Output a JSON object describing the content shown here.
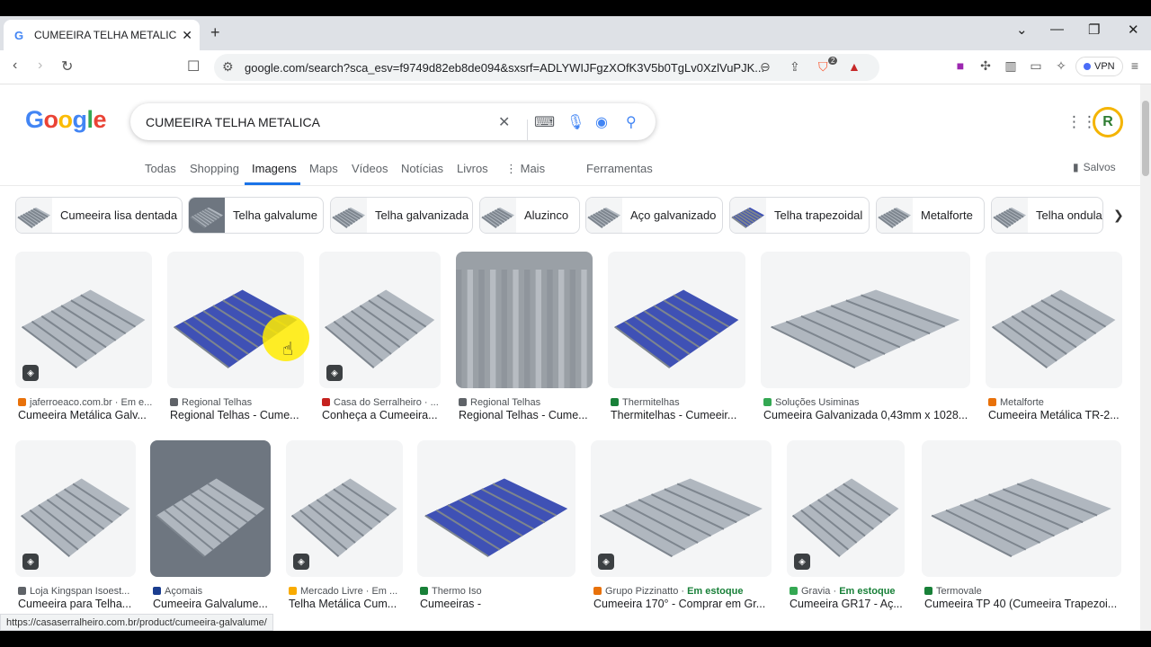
{
  "browser": {
    "tab_title": "CUMEEIRA TELHA METALICA - ",
    "tab_close": "✕",
    "new_tab": "+",
    "url": "google.com/search?sca_esv=f9749d82eb8de094&sxsrf=ADLYWIJFgzXOfK3V5b0TgLv0XzlVuPJK...",
    "vpn_label": "VPN",
    "ext_badge": "2",
    "status_url": "https://casaserralheiro.com.br/product/cumeeira-galvalume/"
  },
  "google": {
    "query": "CUMEEIRA TELHA METALICA",
    "logo_letters": [
      {
        "ch": "G",
        "color": "#4285F4"
      },
      {
        "ch": "o",
        "color": "#EA4335"
      },
      {
        "ch": "o",
        "color": "#FBBC05"
      },
      {
        "ch": "g",
        "color": "#4285F4"
      },
      {
        "ch": "l",
        "color": "#34A853"
      },
      {
        "ch": "e",
        "color": "#EA4335"
      }
    ],
    "tabs": [
      "Todas",
      "Shopping",
      "Imagens",
      "Maps",
      "Vídeos",
      "Notícias",
      "Livros",
      "Mais",
      "Ferramentas"
    ],
    "active_tab": "Imagens",
    "more_dots": "⋮",
    "saved_label": "Salvos",
    "avatar_letter": "R"
  },
  "chips": [
    "Cumeeira lisa dentada",
    "Telha galvalume",
    "Telha galvanizada",
    "Aluzinco",
    "Aço galvanizado",
    "Telha trapezoidal",
    "Metalforte",
    "Telha ondulada"
  ],
  "results_row1": [
    {
      "source": "jaferroeaco.com.br · Em e...",
      "title": "Cumeeira Metálica Galv...",
      "color": "#e8710a"
    },
    {
      "source": "Regional Telhas",
      "title": "Regional Telhas - Cume...",
      "color": "#5f6368"
    },
    {
      "source": "Casa do Serralheiro · ...",
      "title": "Conheça a Cumeeira...",
      "color": "#c5221f"
    },
    {
      "source": "Regional Telhas",
      "title": "Regional Telhas - Cume...",
      "color": "#5f6368"
    },
    {
      "source": "Thermitelhas",
      "title": "Thermitelhas - Cumeeir...",
      "color": "#188038"
    },
    {
      "source": "Soluções Usiminas",
      "title": "Cumeeira Galvanizada 0,43mm x 1028...",
      "color": "#34a853"
    },
    {
      "source": "Metalforte",
      "title": "Cumeeira Metálica TR-2...",
      "color": "#e8710a"
    }
  ],
  "results_row2": [
    {
      "source": "Loja Kingspan Isoest...",
      "title": "Cumeeira para Telha...",
      "color": "#5f6368",
      "stock": ""
    },
    {
      "source": "Açomais",
      "title": "Cumeeira Galvalume...",
      "color": "#1a3d8f",
      "stock": ""
    },
    {
      "source": "Mercado Livre · Em ...",
      "title": "Telha Metálica Cum...",
      "color": "#f9ab00",
      "stock": ""
    },
    {
      "source": "Thermo Iso",
      "title": "Cumeeiras -",
      "color": "#188038",
      "stock": ""
    },
    {
      "source": "Grupo Pizzinatto · ",
      "title": "Cumeeira 170° - Comprar em Gr...",
      "color": "#e8710a",
      "stock": "Em estoque"
    },
    {
      "source": "Gravia · ",
      "title": "Cumeeira GR17 - Aç...",
      "color": "#34a853",
      "stock": "Em estoque"
    },
    {
      "source": "Termovale",
      "title": "Cumeeira TP 40 (Cumeeira Trapezoi...",
      "color": "#188038",
      "stock": ""
    }
  ],
  "colors": {
    "accent": "#1a73e8",
    "stock_green": "#188038"
  }
}
